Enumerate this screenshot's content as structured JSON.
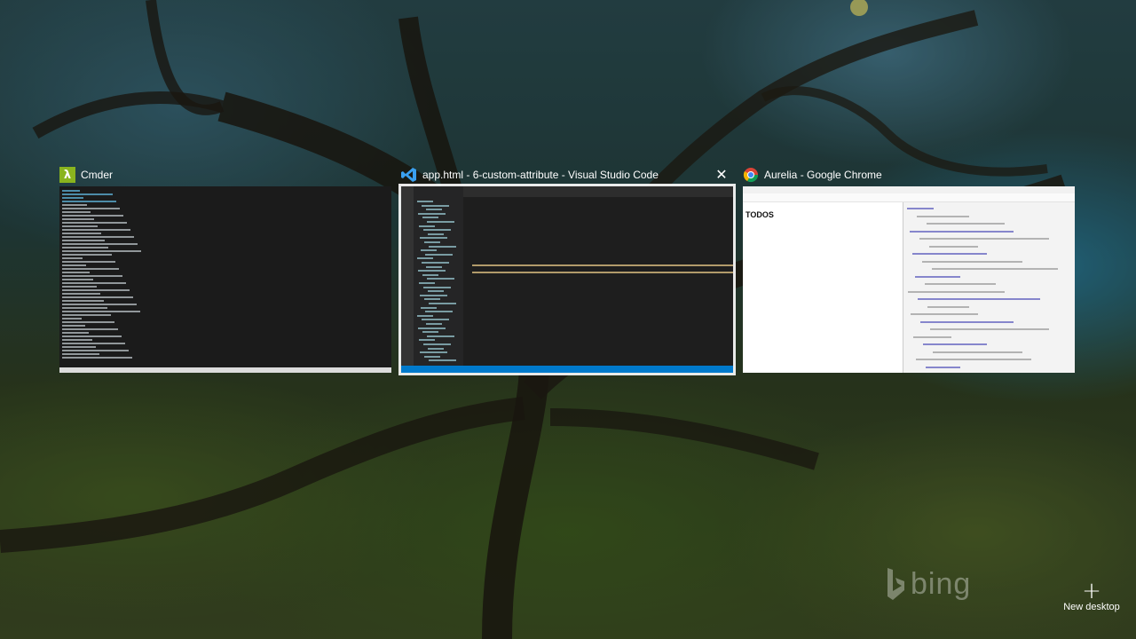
{
  "windows": [
    {
      "title": "Cmder",
      "icon": "lambda-icon"
    },
    {
      "title": "app.html - 6-custom-attribute - Visual Studio Code",
      "icon": "vscode-icon",
      "close": "✕"
    },
    {
      "title": "Aurelia - Google Chrome",
      "icon": "chrome-icon"
    }
  ],
  "chrome_page": {
    "heading": "TODOS"
  },
  "wallpaper": {
    "watermark": "bing"
  },
  "new_desktop": {
    "plus": "+",
    "label": "New desktop"
  },
  "colors": {
    "cmder": "#8ab41e",
    "vscode": "#007acc",
    "accent_outline": "#ffffff"
  }
}
